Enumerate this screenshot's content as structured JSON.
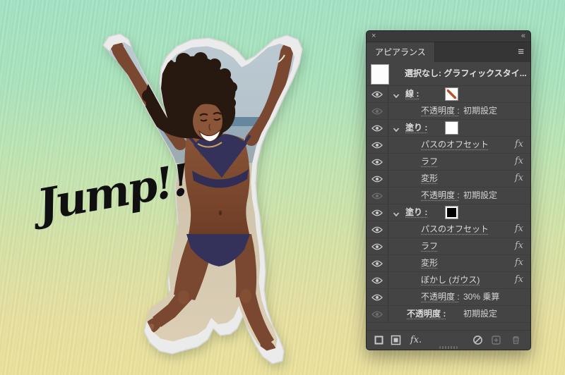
{
  "canvas": {
    "jump_text": "Jump!!",
    "artwork": "jumping-woman-sticker-cutout"
  },
  "panel": {
    "close_icon": "×",
    "collapse_icon": "«",
    "menu_icon": "≡",
    "tab_label": "アピアランス",
    "fx_label": "fx",
    "header_row": {
      "label": "選択なし: グラフィックスタイ...",
      "thumbnail": "white"
    },
    "rows": [
      {
        "kind": "stroke",
        "label": "線 :",
        "swatch": "none",
        "visibility": "on",
        "expanded": true
      },
      {
        "kind": "opacity",
        "label": "不透明度 :",
        "value": "初期設定",
        "visibility": "dimmed",
        "indent": 2
      },
      {
        "kind": "fill",
        "label": "塗り :",
        "swatch": "white",
        "visibility": "on",
        "expanded": true
      },
      {
        "kind": "effect",
        "label": "パスのオフセット",
        "visibility": "on",
        "indent": 2,
        "fx": true
      },
      {
        "kind": "effect",
        "label": "ラフ",
        "visibility": "on",
        "indent": 2,
        "fx": true
      },
      {
        "kind": "effect",
        "label": "変形",
        "visibility": "on",
        "indent": 2,
        "fx": true
      },
      {
        "kind": "opacity",
        "label": "不透明度 :",
        "value": "初期設定",
        "visibility": "dimmed",
        "indent": 2
      },
      {
        "kind": "fill",
        "label": "塗り :",
        "swatch": "black",
        "visibility": "on",
        "expanded": true
      },
      {
        "kind": "effect",
        "label": "パスのオフセット",
        "visibility": "on",
        "indent": 2,
        "fx": true
      },
      {
        "kind": "effect",
        "label": "ラフ",
        "visibility": "on",
        "indent": 2,
        "fx": true
      },
      {
        "kind": "effect",
        "label": "変形",
        "visibility": "on",
        "indent": 2,
        "fx": true
      },
      {
        "kind": "effect",
        "label": "ぼかし (ガウス)",
        "visibility": "on",
        "indent": 2,
        "fx": true
      },
      {
        "kind": "opacity",
        "label": "不透明度 :",
        "value": "30% 乗算",
        "visibility": "on",
        "indent": 2
      },
      {
        "kind": "opacity",
        "label": "不透明度 :",
        "value": "初期設定",
        "visibility": "dimmed",
        "indent": 1
      }
    ],
    "footer": {
      "add_effect_label": "fx."
    }
  },
  "colors": {
    "background_top": "#a2e3c5",
    "background_bottom": "#ece29b",
    "panel_bg": "#444444",
    "panel_dark": "#353535",
    "none_swatch_slash": "#b5552f",
    "sticker_edge": "#ebebeb",
    "photo_sky": "#bcc9d1",
    "photo_sea": "#5d8199",
    "photo_sand": "#d3c6ad",
    "skin": "#8a5538",
    "hair": "#27190f",
    "bikini": "#34325a",
    "jump_text": "#101010"
  }
}
